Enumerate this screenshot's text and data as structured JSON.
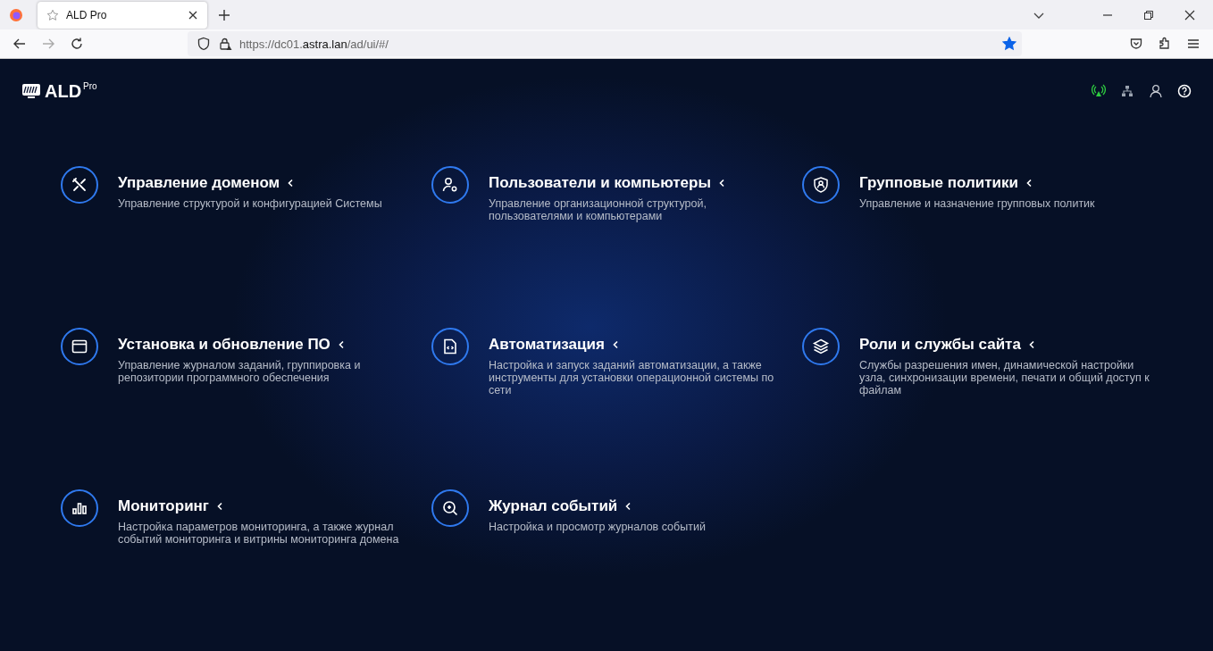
{
  "browser": {
    "tab": {
      "title": "ALD Pro",
      "selected": true
    },
    "url": {
      "before": "https://dc01.",
      "host": "astra.lan",
      "after": "/ad/ui/#/"
    },
    "bookmarked": true
  },
  "header": {
    "logo": "ALD",
    "logo_sup": "Pro",
    "status_icons": [
      {
        "kind": "antenna",
        "active": true
      },
      {
        "kind": "network",
        "active": false
      },
      {
        "kind": "user",
        "active": false
      },
      {
        "kind": "help",
        "active": false
      }
    ]
  },
  "sections": [
    {
      "kind": "tools",
      "title": "Управление доменом",
      "description": "Управление структурой и конфигурацией Системы"
    },
    {
      "kind": "user-gear",
      "title": "Пользователи и компьютеры",
      "description": "Управление организационной структурой, пользователями и компьютерами"
    },
    {
      "kind": "shield",
      "title": "Групповые политики",
      "description": "Управление и назначение групповых политик"
    },
    {
      "kind": "window",
      "title": "Установка и обновление ПО",
      "description": "Управление журналом заданий, группировка и репозитории программного обеспечения"
    },
    {
      "kind": "code-file",
      "title": "Автоматизация",
      "description": "Настройка и запуск заданий автоматизации, а также инструменты для установки операционной системы по сети"
    },
    {
      "kind": "layers",
      "title": "Роли и службы сайта",
      "description": "Службы разрешения имен, динамической настройки узла, синхронизации времени, печати и общий доступ к файлам"
    },
    {
      "kind": "chart",
      "title": "Мониторинг",
      "description": "Настройка параметров мониторинга, а также журнал событий мониторинга и витрины мониторинга домена"
    },
    {
      "kind": "search",
      "title": "Журнал событий",
      "description": "Настройка и просмотр журналов событий"
    }
  ]
}
